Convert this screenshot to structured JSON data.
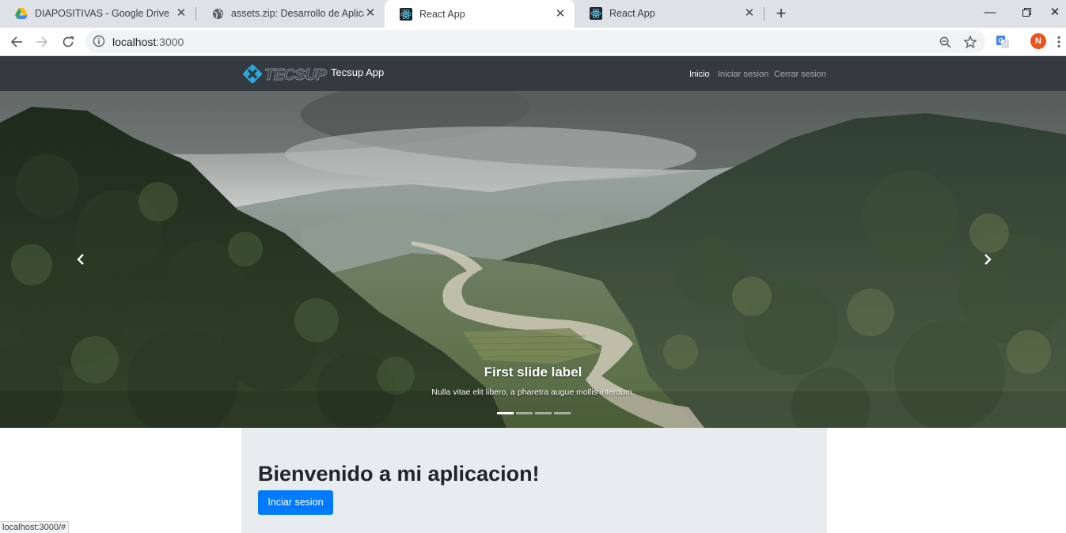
{
  "browser": {
    "tabs": [
      {
        "title": "DIAPOSITIVAS - Google Drive",
        "icon": "google-drive-icon",
        "active": false
      },
      {
        "title": "assets.zip: Desarrollo de Aplicacio",
        "icon": "globe-icon",
        "active": false
      },
      {
        "title": "React App",
        "icon": "react-icon",
        "active": true
      },
      {
        "title": "React App",
        "icon": "react-icon",
        "active": false
      }
    ],
    "address": {
      "host": "localhost",
      "port": ":3000"
    },
    "profile_initial": "N",
    "status_url": "localhost:3000/#"
  },
  "app": {
    "brand": "Tecsup App",
    "logo_text": "TECSUP",
    "nav": [
      {
        "label": "Inicio",
        "active": true
      },
      {
        "label": "Iniciar sesion",
        "active": false
      },
      {
        "label": "Cerrar sesion",
        "active": false
      }
    ],
    "carousel": {
      "caption_title": "First slide label",
      "caption_text": "Nulla vitae elit libero, a pharetra augue mollis interdum.",
      "slide_count": 4,
      "active_slide": 1
    },
    "jumbotron": {
      "title": "Bienvenido a mi aplicacion!",
      "button_label": "Inciar sesion"
    }
  },
  "colors": {
    "navbar_bg": "#343a40",
    "primary": "#007bff",
    "jumbotron_bg": "#e9ecef"
  }
}
